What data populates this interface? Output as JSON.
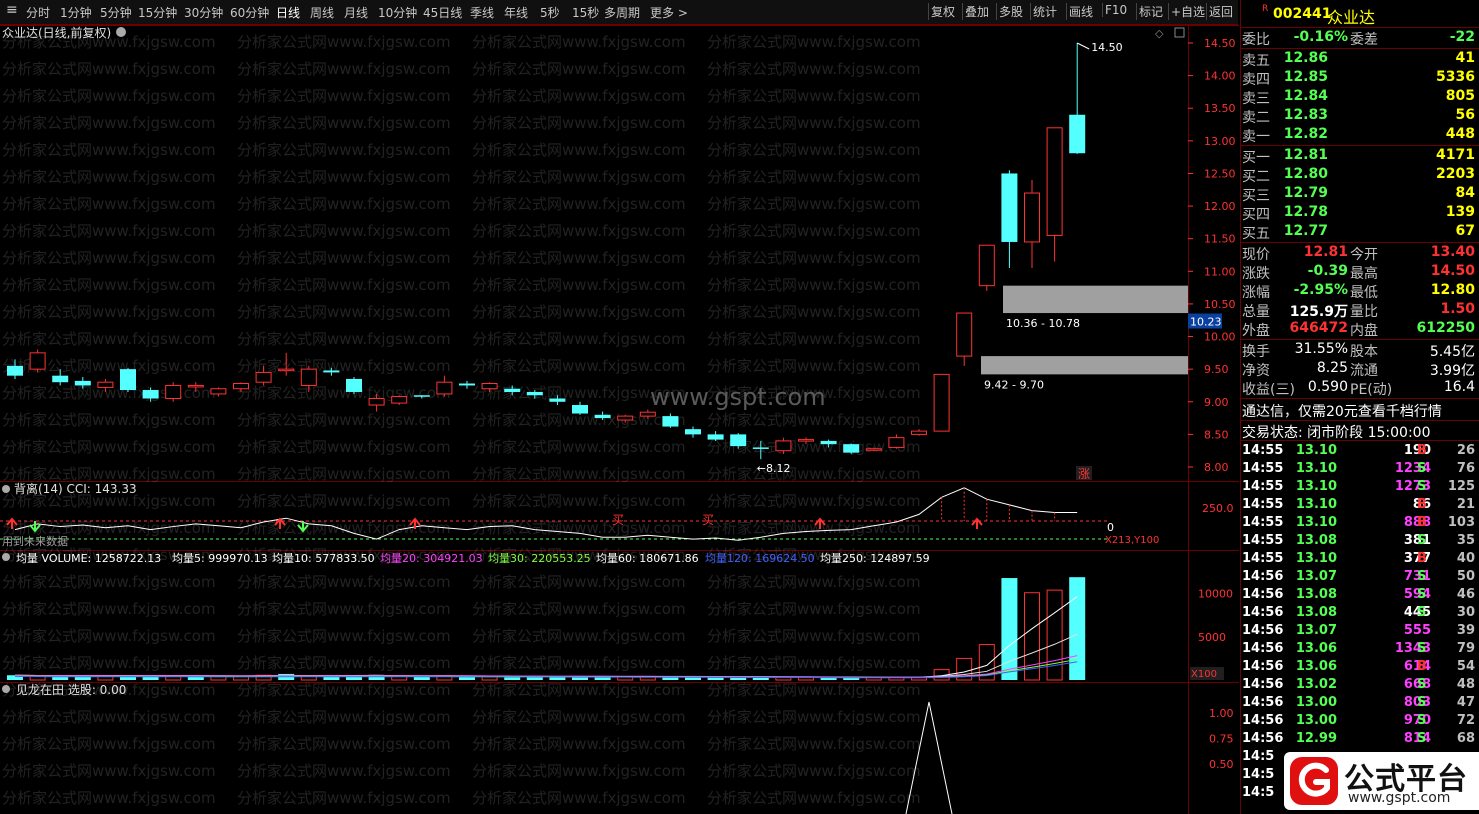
{
  "toolbar": {
    "periods": [
      "分时",
      "1分钟",
      "5分钟",
      "15分钟",
      "30分钟",
      "60分钟",
      "日线",
      "周线",
      "月线",
      "10分钟",
      "45日线",
      "季线",
      "年线",
      "5秒",
      "15秒",
      "多周期",
      "更多 >"
    ],
    "active_period": "日线",
    "right_buttons": [
      "复权",
      "叠加",
      "多股",
      "统计",
      "画线",
      "F10",
      "标记",
      "+自选",
      "返回"
    ]
  },
  "main_chart": {
    "title": "众业达(日线,前复权)",
    "y_ticks": [
      "14.50",
      "14.00",
      "13.50",
      "13.00",
      "12.50",
      "12.00",
      "11.50",
      "11.00",
      "10.50",
      "10.00",
      "9.50",
      "9.00",
      "8.50",
      "8.00"
    ],
    "high_label": "14.50",
    "low_label": "8.12",
    "current_price_tag": "10.23",
    "zone_upper_label": "10.36 - 10.78",
    "zone_lower_label": "9.42 - 9.70",
    "up_mark": "涨",
    "watermark_text": "分析家公式网www.fxjgsw.com",
    "center_watermark": "www.gspt.com",
    "colors": {
      "up": "#ff3232",
      "down": "#54ffff",
      "axis": "#ff3232",
      "grid": "#6b0000",
      "zone": "#a0a0a0"
    },
    "candles": [
      {
        "o": 9.55,
        "h": 9.65,
        "l": 9.35,
        "c": 9.4
      },
      {
        "o": 9.5,
        "h": 9.8,
        "l": 9.45,
        "c": 9.75
      },
      {
        "o": 9.4,
        "h": 9.5,
        "l": 9.25,
        "c": 9.3
      },
      {
        "o": 9.32,
        "h": 9.38,
        "l": 9.2,
        "c": 9.25
      },
      {
        "o": 9.22,
        "h": 9.35,
        "l": 9.15,
        "c": 9.3
      },
      {
        "o": 9.5,
        "h": 9.52,
        "l": 9.15,
        "c": 9.18
      },
      {
        "o": 9.18,
        "h": 9.22,
        "l": 9.0,
        "c": 9.05
      },
      {
        "o": 9.05,
        "h": 9.3,
        "l": 9.0,
        "c": 9.25
      },
      {
        "o": 9.25,
        "h": 9.3,
        "l": 9.15,
        "c": 9.25
      },
      {
        "o": 9.12,
        "h": 9.22,
        "l": 9.08,
        "c": 9.2
      },
      {
        "o": 9.2,
        "h": 9.3,
        "l": 9.15,
        "c": 9.28
      },
      {
        "o": 9.3,
        "h": 9.55,
        "l": 9.25,
        "c": 9.45
      },
      {
        "o": 9.5,
        "h": 9.75,
        "l": 9.4,
        "c": 9.5
      },
      {
        "o": 9.25,
        "h": 9.55,
        "l": 9.15,
        "c": 9.5
      },
      {
        "o": 9.48,
        "h": 9.52,
        "l": 9.4,
        "c": 9.45
      },
      {
        "o": 9.35,
        "h": 9.38,
        "l": 9.12,
        "c": 9.15
      },
      {
        "o": 8.95,
        "h": 9.12,
        "l": 8.85,
        "c": 9.05
      },
      {
        "o": 8.98,
        "h": 9.1,
        "l": 8.95,
        "c": 9.08
      },
      {
        "o": 9.1,
        "h": 9.1,
        "l": 9.05,
        "c": 9.08
      },
      {
        "o": 9.12,
        "h": 9.4,
        "l": 9.08,
        "c": 9.3
      },
      {
        "o": 9.28,
        "h": 9.32,
        "l": 9.2,
        "c": 9.25
      },
      {
        "o": 9.2,
        "h": 9.3,
        "l": 9.15,
        "c": 9.28
      },
      {
        "o": 9.2,
        "h": 9.25,
        "l": 9.1,
        "c": 9.15
      },
      {
        "o": 9.15,
        "h": 9.18,
        "l": 9.05,
        "c": 9.1
      },
      {
        "o": 9.05,
        "h": 9.1,
        "l": 8.95,
        "c": 9.0
      },
      {
        "o": 8.95,
        "h": 9.0,
        "l": 8.8,
        "c": 8.82
      },
      {
        "o": 8.8,
        "h": 8.85,
        "l": 8.72,
        "c": 8.75
      },
      {
        "o": 8.72,
        "h": 8.8,
        "l": 8.68,
        "c": 8.78
      },
      {
        "o": 8.78,
        "h": 8.88,
        "l": 8.74,
        "c": 8.84
      },
      {
        "o": 8.78,
        "h": 8.82,
        "l": 8.6,
        "c": 8.62
      },
      {
        "o": 8.58,
        "h": 8.62,
        "l": 8.45,
        "c": 8.5
      },
      {
        "o": 8.5,
        "h": 8.55,
        "l": 8.4,
        "c": 8.42
      },
      {
        "o": 8.5,
        "h": 8.52,
        "l": 8.28,
        "c": 8.32
      },
      {
        "o": 8.3,
        "h": 8.4,
        "l": 8.12,
        "c": 8.28
      },
      {
        "o": 8.25,
        "h": 8.45,
        "l": 8.2,
        "c": 8.4
      },
      {
        "o": 8.4,
        "h": 8.45,
        "l": 8.35,
        "c": 8.42
      },
      {
        "o": 8.4,
        "h": 8.42,
        "l": 8.3,
        "c": 8.35
      },
      {
        "o": 8.35,
        "h": 8.36,
        "l": 8.2,
        "c": 8.22
      },
      {
        "o": 8.28,
        "h": 8.3,
        "l": 8.24,
        "c": 8.28
      },
      {
        "o": 8.3,
        "h": 8.5,
        "l": 8.28,
        "c": 8.45
      },
      {
        "o": 8.5,
        "h": 8.58,
        "l": 8.48,
        "c": 8.55
      },
      {
        "o": 8.55,
        "h": 9.42,
        "l": 8.55,
        "c": 9.42
      },
      {
        "o": 9.7,
        "h": 10.36,
        "l": 9.55,
        "c": 10.36
      },
      {
        "o": 10.78,
        "h": 11.4,
        "l": 10.7,
        "c": 11.4
      },
      {
        "o": 12.5,
        "h": 12.55,
        "l": 11.05,
        "c": 11.45
      },
      {
        "o": 11.45,
        "h": 12.4,
        "l": 11.05,
        "c": 12.2
      },
      {
        "o": 11.55,
        "h": 13.2,
        "l": 11.15,
        "c": 13.2
      },
      {
        "o": 13.4,
        "h": 14.5,
        "l": 12.8,
        "c": 12.81
      }
    ]
  },
  "cci_panel": {
    "title": "背离(14) CCI: 143.33",
    "level": "250.0",
    "zero_label": "0",
    "buy_label": "买",
    "note": "X213,Y100",
    "bottom_text": "用到未来数据"
  },
  "volume_panel": {
    "items": [
      {
        "label": "均量 VOLUME: 1258722.13",
        "color": "#ffffff"
      },
      {
        "label": "均量5: 999970.13",
        "color": "#ffffff"
      },
      {
        "label": "均量10: 577833.50",
        "color": "#ffffff"
      },
      {
        "label": "均量20: 304921.03",
        "color": "#ff40ff"
      },
      {
        "label": "均量30: 220553.25",
        "color": "#7fff40"
      },
      {
        "label": "均量60: 180671.86",
        "color": "#ffffff"
      },
      {
        "label": "均量120: 169624.50",
        "color": "#4060ff"
      },
      {
        "label": "均量250: 124897.59",
        "color": "#ffffff"
      }
    ],
    "y_ticks": [
      "10000",
      "5000"
    ],
    "unit": "X100",
    "bars": [
      0.55,
      0.5,
      0.45,
      0.5,
      0.5,
      0.55,
      0.45,
      0.5,
      0.5,
      0.4,
      0.45,
      0.55,
      0.7,
      0.45,
      0.45,
      0.45,
      0.6,
      0.45,
      0.35,
      0.5,
      0.35,
      0.35,
      0.35,
      0.35,
      0.35,
      0.4,
      0.35,
      0.35,
      0.35,
      0.35,
      0.35,
      0.35,
      0.35,
      0.35,
      0.35,
      0.35,
      0.3,
      0.3,
      0.3,
      0.3,
      0.35,
      1.2,
      2.5,
      4.1,
      11.8,
      10.1,
      10.4,
      11.9
    ],
    "bar_up": [
      false,
      true,
      false,
      false,
      true,
      false,
      false,
      true,
      false,
      true,
      true,
      true,
      false,
      true,
      false,
      false,
      false,
      true,
      false,
      true,
      false,
      true,
      false,
      false,
      false,
      false,
      false,
      true,
      true,
      false,
      false,
      false,
      false,
      false,
      true,
      true,
      false,
      false,
      true,
      true,
      true,
      true,
      true,
      true,
      false,
      true,
      true,
      false
    ]
  },
  "signal_panel": {
    "title": "见龙在田 选股: 0.00",
    "y_ticks": [
      "1.00",
      "0.75",
      "0.50"
    ]
  },
  "right_panel": {
    "badge": "R",
    "code": "002441",
    "name": "众业达",
    "commission": {
      "label": "委比",
      "value": "-0.16%",
      "label2": "委差",
      "value2": "-22"
    },
    "asks": [
      {
        "label": "卖五",
        "price": "12.86",
        "vol": "41"
      },
      {
        "label": "卖四",
        "price": "12.85",
        "vol": "5336"
      },
      {
        "label": "卖三",
        "price": "12.84",
        "vol": "805"
      },
      {
        "label": "卖二",
        "price": "12.83",
        "vol": "56"
      },
      {
        "label": "卖一",
        "price": "12.82",
        "vol": "448"
      }
    ],
    "bids": [
      {
        "label": "买一",
        "price": "12.81",
        "vol": "4171"
      },
      {
        "label": "买二",
        "price": "12.80",
        "vol": "2203"
      },
      {
        "label": "买三",
        "price": "12.79",
        "vol": "84"
      },
      {
        "label": "买四",
        "price": "12.78",
        "vol": "139"
      },
      {
        "label": "买五",
        "price": "12.77",
        "vol": "67"
      }
    ],
    "quote": [
      {
        "l1": "现价",
        "v1": "12.81",
        "c1": "#ff3232",
        "l2": "今开",
        "v2": "13.40",
        "c2": "#ff3232"
      },
      {
        "l1": "涨跌",
        "v1": "-0.39",
        "c1": "#54ff54",
        "l2": "最高",
        "v2": "14.50",
        "c2": "#ff3232"
      },
      {
        "l1": "涨幅",
        "v1": "-2.95%",
        "c1": "#54ff54",
        "l2": "最低",
        "v2": "12.80",
        "c2": "#ffff00"
      },
      {
        "l1": "总量",
        "v1": "125.9万",
        "c1": "#ffffff",
        "l2": "量比",
        "v2": "1.50",
        "c2": "#ff3232"
      },
      {
        "l1": "外盘",
        "v1": "646472",
        "c1": "#ff3232",
        "l2": "内盘",
        "v2": "612250",
        "c2": "#54ff54"
      }
    ],
    "stats": [
      {
        "l1": "换手",
        "v1": "31.55%",
        "l2": "股本",
        "v2": "5.45亿"
      },
      {
        "l1": "净资",
        "v1": "8.25",
        "l2": "流通",
        "v2": "3.99亿"
      },
      {
        "l1": "收益(三)",
        "v1": "0.590",
        "l2": "PE(动)",
        "v2": "16.4"
      }
    ],
    "promo": "通达信，仅需20元查看千档行情",
    "trade_status": "交易状态: 闭市阶段 15:00:00",
    "ticks": [
      {
        "t": "14:55",
        "p": "13.10",
        "v": "190",
        "s": "B",
        "n": "26"
      },
      {
        "t": "14:55",
        "p": "13.10",
        "v": "1234",
        "s": "S",
        "n": "76"
      },
      {
        "t": "14:55",
        "p": "13.10",
        "v": "1273",
        "s": "S",
        "n": "125"
      },
      {
        "t": "14:55",
        "p": "13.10",
        "v": "86",
        "s": "B",
        "n": "21"
      },
      {
        "t": "14:55",
        "p": "13.10",
        "v": "888",
        "s": "B",
        "n": "103"
      },
      {
        "t": "14:55",
        "p": "13.08",
        "v": "381",
        "s": "S",
        "n": "35"
      },
      {
        "t": "14:55",
        "p": "13.10",
        "v": "377",
        "s": "B",
        "n": "40"
      },
      {
        "t": "14:56",
        "p": "13.07",
        "v": "731",
        "s": "S",
        "n": "50"
      },
      {
        "t": "14:56",
        "p": "13.08",
        "v": "594",
        "s": "S",
        "n": "46"
      },
      {
        "t": "14:56",
        "p": "13.08",
        "v": "445",
        "s": "S",
        "n": "30"
      },
      {
        "t": "14:56",
        "p": "13.07",
        "v": "555",
        "s": "",
        "n": "39"
      },
      {
        "t": "14:56",
        "p": "13.06",
        "v": "1343",
        "s": "S",
        "n": "79"
      },
      {
        "t": "14:56",
        "p": "13.06",
        "v": "614",
        "s": "B",
        "n": "54"
      },
      {
        "t": "14:56",
        "p": "13.02",
        "v": "668",
        "s": "S",
        "n": "48"
      },
      {
        "t": "14:56",
        "p": "13.00",
        "v": "803",
        "s": "S",
        "n": "47"
      },
      {
        "t": "14:56",
        "p": "13.00",
        "v": "970",
        "s": "S",
        "n": "72"
      },
      {
        "t": "14:56",
        "p": "12.99",
        "v": "814",
        "s": "S",
        "n": "68"
      },
      {
        "t": "14:5",
        "p": "",
        "v": "",
        "s": "",
        "n": ""
      },
      {
        "t": "14:5",
        "p": "",
        "v": "",
        "s": "",
        "n": ""
      },
      {
        "t": "14:5",
        "p": "",
        "v": "",
        "s": "",
        "n": ""
      }
    ],
    "logo_text": "公式平台",
    "logo_url": "www.gspt.com"
  }
}
